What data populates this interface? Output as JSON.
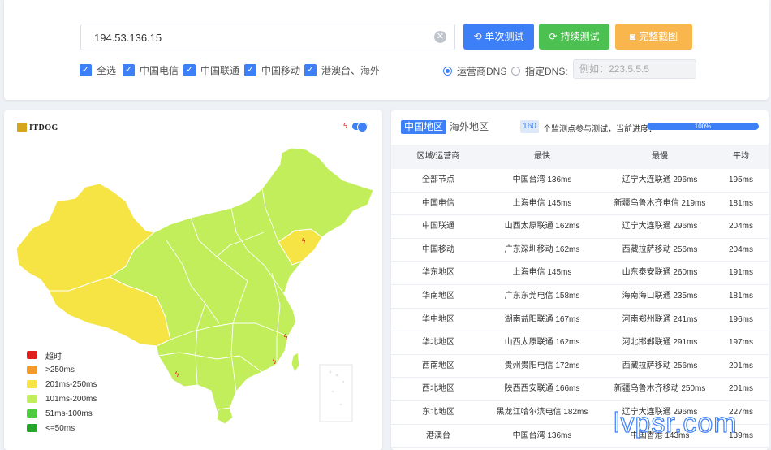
{
  "search": {
    "ip": "194.53.136.15"
  },
  "buttons": {
    "single": "单次测试",
    "continuous": "持续测试",
    "screenshot": "完整截图"
  },
  "filters": [
    "全选",
    "中国电信",
    "中国联通",
    "中国移动",
    "港澳台、海外"
  ],
  "dns": {
    "carrier_label": "运营商DNS",
    "custom_label": "指定DNS:",
    "custom_placeholder": "例如：223.5.5.5",
    "selected": "运营商DNS"
  },
  "map": {
    "logo": "ITDOG",
    "legend": [
      {
        "label": "超时",
        "color": "#e01f1f"
      },
      {
        "label": ">250ms",
        "color": "#f39a2b"
      },
      {
        "label": "201ms-250ms",
        "color": "#f5e443"
      },
      {
        "label": "101ms-200ms",
        "color": "#c1ee5a"
      },
      {
        "label": "51ms-100ms",
        "color": "#4ecb3f"
      },
      {
        "label": "<=50ms",
        "color": "#24a52c"
      }
    ],
    "auto_toggle": true
  },
  "results": {
    "tabs": [
      "中国地区",
      "海外地区"
    ],
    "active_tab": "中国地区",
    "node_count": "160",
    "count_text": "个监测点参与测试，当前进度：",
    "progress_label": "100%",
    "progress": 1.0,
    "headers": [
      "区域/运营商",
      "最快",
      "最慢",
      "平均"
    ],
    "rows": [
      {
        "region": "全部节点",
        "fast": "中国台湾 136ms",
        "slow": "辽宁大连联通 296ms",
        "avg": "195ms"
      },
      {
        "region": "中国电信",
        "fast": "上海电信 145ms",
        "slow": "新疆乌鲁木齐电信 219ms",
        "avg": "181ms"
      },
      {
        "region": "中国联通",
        "fast": "山西太原联通 162ms",
        "slow": "辽宁大连联通 296ms",
        "avg": "204ms"
      },
      {
        "region": "中国移动",
        "fast": "广东深圳移动 162ms",
        "slow": "西藏拉萨移动 256ms",
        "avg": "204ms"
      },
      {
        "region": "华东地区",
        "fast": "上海电信 145ms",
        "slow": "山东泰安联通 260ms",
        "avg": "191ms"
      },
      {
        "region": "华南地区",
        "fast": "广东东莞电信 158ms",
        "slow": "海南海口联通 235ms",
        "avg": "181ms"
      },
      {
        "region": "华中地区",
        "fast": "湖南益阳联通 167ms",
        "slow": "河南郑州联通 241ms",
        "avg": "196ms"
      },
      {
        "region": "华北地区",
        "fast": "山西太原联通 162ms",
        "slow": "河北邯郸联通 291ms",
        "avg": "197ms"
      },
      {
        "region": "西南地区",
        "fast": "贵州贵阳电信 172ms",
        "slow": "西藏拉萨移动 256ms",
        "avg": "201ms"
      },
      {
        "region": "西北地区",
        "fast": "陕西西安联通 166ms",
        "slow": "新疆乌鲁木齐移动 250ms",
        "avg": "201ms"
      },
      {
        "region": "东北地区",
        "fast": "黑龙江哈尔滨电信 182ms",
        "slow": "辽宁大连联通 296ms",
        "avg": "227ms"
      },
      {
        "region": "港澳台",
        "fast": "中国台湾 136ms",
        "slow": "中国香港 143ms",
        "avg": "139ms"
      }
    ]
  },
  "watermark": "lvpsr.com"
}
